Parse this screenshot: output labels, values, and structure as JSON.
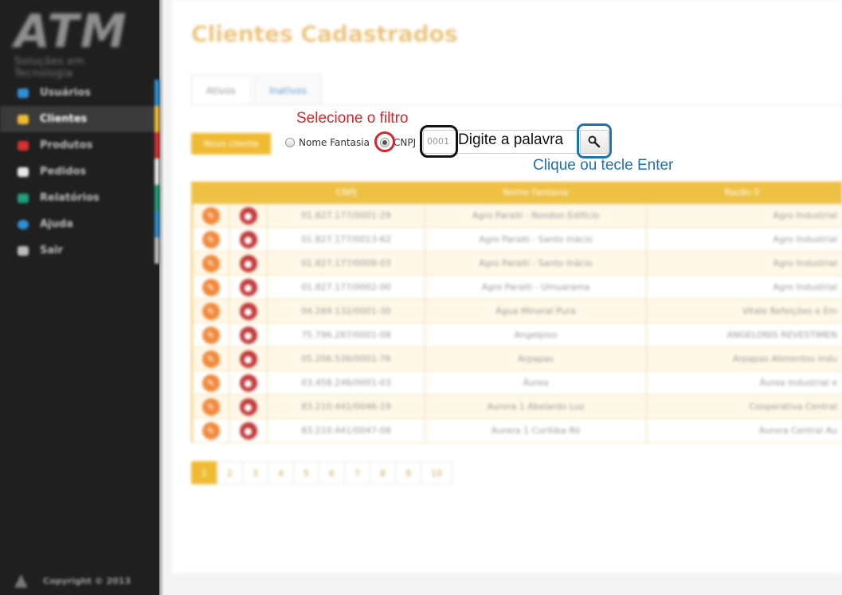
{
  "sidebar": {
    "logo_mark": "ATM",
    "logo_sub": "Soluções em Tecnologia",
    "items": [
      {
        "label": "Usuários",
        "icon": "users-icon",
        "icon_color": "#2e8fd6",
        "bar_color": "#2e8fd6"
      },
      {
        "label": "Clientes",
        "icon": "client-icon",
        "icon_color": "#f0bb33",
        "bar_color": "#f0bb33",
        "active": true
      },
      {
        "label": "Produtos",
        "icon": "product-icon",
        "icon_color": "#d9312f",
        "bar_color": "#d9312f"
      },
      {
        "label": "Pedidos",
        "icon": "order-icon",
        "icon_color": "#e8e8e8",
        "bar_color": "#e8e8e8"
      },
      {
        "label": "Relatórios",
        "icon": "chart-icon",
        "icon_color": "#1fa07a",
        "bar_color": "#1fa07a"
      },
      {
        "label": "Ajuda",
        "icon": "help-icon",
        "icon_color": "#2e8fd6",
        "bar_color": "#2e8fd6"
      },
      {
        "label": "Sair",
        "icon": "exit-icon",
        "icon_color": "#bbbbbb",
        "bar_color": "#bbbbbb"
      }
    ],
    "copyright": "Copyright © 2013"
  },
  "main": {
    "title": "Clientes Cadastrados",
    "tabs": [
      {
        "label": "Ativos",
        "active": true
      },
      {
        "label": "Inativos",
        "active": false
      }
    ],
    "new_button": "Novo cliente",
    "annotations": {
      "filter": "Selecione o filtro",
      "search_hint": "Digite a palavra",
      "enter_hint": "Clique ou tecle Enter"
    },
    "filters": {
      "option1": "Nome Fantasia",
      "option2": "CNPJ",
      "selected": "CNPJ"
    },
    "search": {
      "placeholder": "0001",
      "value": ""
    },
    "table": {
      "headers": [
        "CNPJ",
        "Nome Fantasia",
        "Razão S"
      ],
      "rows": [
        {
          "cnpj": "01.827.177/0001-29",
          "fantasia": "Agro Paraiti - Rondon Edifício",
          "razao": "Agro Industrial"
        },
        {
          "cnpj": "01.827.177/0013-62",
          "fantasia": "Agro Paraiti - Santo Inácio",
          "razao": "Agro Industrial"
        },
        {
          "cnpj": "01.827.177/0008-03",
          "fantasia": "Agro Paraiti - Santo Inácio",
          "razao": "Agro Industrial"
        },
        {
          "cnpj": "01.827.177/0002-00",
          "fantasia": "Agro Paraiti - Umuarama",
          "razao": "Agro Industrial"
        },
        {
          "cnpj": "04.269.132/0001-30",
          "fantasia": "Água Mineral Pura",
          "razao": "Vitale Refeições e Em"
        },
        {
          "cnpj": "75.796.287/0001-08",
          "fantasia": "Angelpiso",
          "razao": "ANGELONIS REVESTIMEN"
        },
        {
          "cnpj": "05.206.536/0001-76",
          "fantasia": "Arpapas",
          "razao": "Arpapas Alimentos Indu"
        },
        {
          "cnpj": "03.458.246/0001-03",
          "fantasia": "Áurea",
          "razao": "Áurea Industrial e"
        },
        {
          "cnpj": "83.210.441/0046-19",
          "fantasia": "Aurora 1 Abelardo Luz",
          "razao": "Cooperativa Central"
        },
        {
          "cnpj": "83.210.441/0047-08",
          "fantasia": "Aurora 1 Curitiba Ró",
          "razao": "Aurora Central Au"
        }
      ]
    },
    "pagination": [
      "1",
      "2",
      "3",
      "4",
      "5",
      "6",
      "7",
      "8",
      "9",
      "10"
    ],
    "current_page": "1"
  }
}
